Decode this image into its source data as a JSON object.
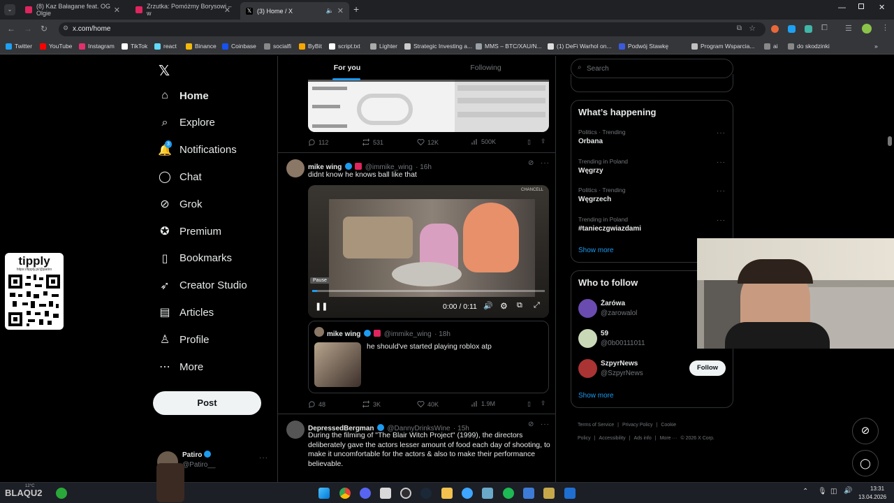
{
  "browser": {
    "tabs": [
      {
        "title": "(8) Kaz Bałagane feat. OG Olgie",
        "fav": "#e0245e"
      },
      {
        "title": "Zrzutka: Pomóżmy Borysowi – w",
        "fav": "#e0245e"
      },
      {
        "title": "(3) Home / X",
        "fav": "#ffffff"
      }
    ],
    "url": "x.com/home",
    "bookmarks": [
      "Twitter",
      "YouTube",
      "Instagram",
      "TikTok",
      "react",
      "Binance",
      "Coinbase",
      "socialfi",
      "ByBit",
      "script.txt",
      "Lighter",
      "Strategic Investing a...",
      "MMS – BTC/XAU/N...",
      "(1) DeFi Warhol on...",
      "Podwój Stawkę",
      "Program Wsparcia...",
      "ai",
      "do skodzinki"
    ]
  },
  "sidebar": {
    "items": [
      {
        "label": "Home",
        "icon": "home-icon"
      },
      {
        "label": "Explore",
        "icon": "search-icon"
      },
      {
        "label": "Notifications",
        "icon": "bell-icon",
        "badge": "3"
      },
      {
        "label": "Chat",
        "icon": "chat-icon"
      },
      {
        "label": "Grok",
        "icon": "grok-icon"
      },
      {
        "label": "Premium",
        "icon": "premium-icon"
      },
      {
        "label": "Bookmarks",
        "icon": "bookmark-icon"
      },
      {
        "label": "Creator Studio",
        "icon": "rocket-icon"
      },
      {
        "label": "Articles",
        "icon": "article-icon"
      },
      {
        "label": "Profile",
        "icon": "profile-icon"
      },
      {
        "label": "More",
        "icon": "more-icon"
      }
    ],
    "post_label": "Post",
    "account": {
      "name": "Patiro",
      "handle": "@Patiro__"
    }
  },
  "feed": {
    "tabs": [
      "For you",
      "Following"
    ],
    "post0": {
      "replies": "112",
      "reposts": "531",
      "likes": "12K",
      "views": "500K"
    },
    "post1": {
      "name": "mike wing",
      "handle": "@immike_wing",
      "time": "· 16h",
      "text": "didnt know he knows ball like that",
      "video": {
        "tooltip": "Pause",
        "time": "0:00 / 0:11",
        "watermark": "CHANCELL",
        "progress": 0.02
      },
      "quote": {
        "name": "mike wing",
        "handle": "@immike_wing",
        "time": "· 18h",
        "text": "he should've started playing roblox atp"
      },
      "replies": "48",
      "reposts": "3K",
      "likes": "40K",
      "views": "1.9M"
    },
    "post2": {
      "name": "DepressedBergman",
      "handle": "@DannyDrinksWine",
      "time": "· 15h",
      "lines": [
        "During the filming of \"The Blair Witch Project\" (1999), the directors",
        "deliberately gave the actors lesser amount of food each day of shooting, to",
        "make it uncomfortable for the actors & also to make their performance",
        "believable."
      ]
    }
  },
  "right": {
    "search_placeholder": "Search",
    "happening_title": "What’s happening",
    "trends": [
      {
        "cat": "Politics · Trending",
        "name": "Orbana"
      },
      {
        "cat": "Trending in Poland",
        "name": "Węgrzy"
      },
      {
        "cat": "Politics · Trending",
        "name": "Węgrzech"
      },
      {
        "cat": "Trending in Poland",
        "name": "#tanieczgwiazdami"
      }
    ],
    "show_more": "Show more",
    "follow_title": "Who to follow",
    "follow": [
      {
        "name": "Żarówa",
        "handle": "@zarowalol"
      },
      {
        "name": "59",
        "handle": "@0b00111011"
      },
      {
        "name": "SzpyrNews",
        "handle": "@SzpyrNews",
        "button": "Follow"
      }
    ],
    "footer": [
      "Terms of Service",
      "|",
      "Privacy Policy",
      "|",
      "Cookie Policy",
      "|",
      "Accessibility",
      "|",
      "Ads info",
      "|",
      "More ···",
      "© 2026 X Corp."
    ]
  },
  "overlay": {
    "tipply": "tipply",
    "tipply_url": "https://tipply.pl/@patiro"
  },
  "taskbar": {
    "time": "13:31",
    "date": "13.04.2026",
    "left_text": "BLAQU2",
    "temp": "12°C"
  }
}
